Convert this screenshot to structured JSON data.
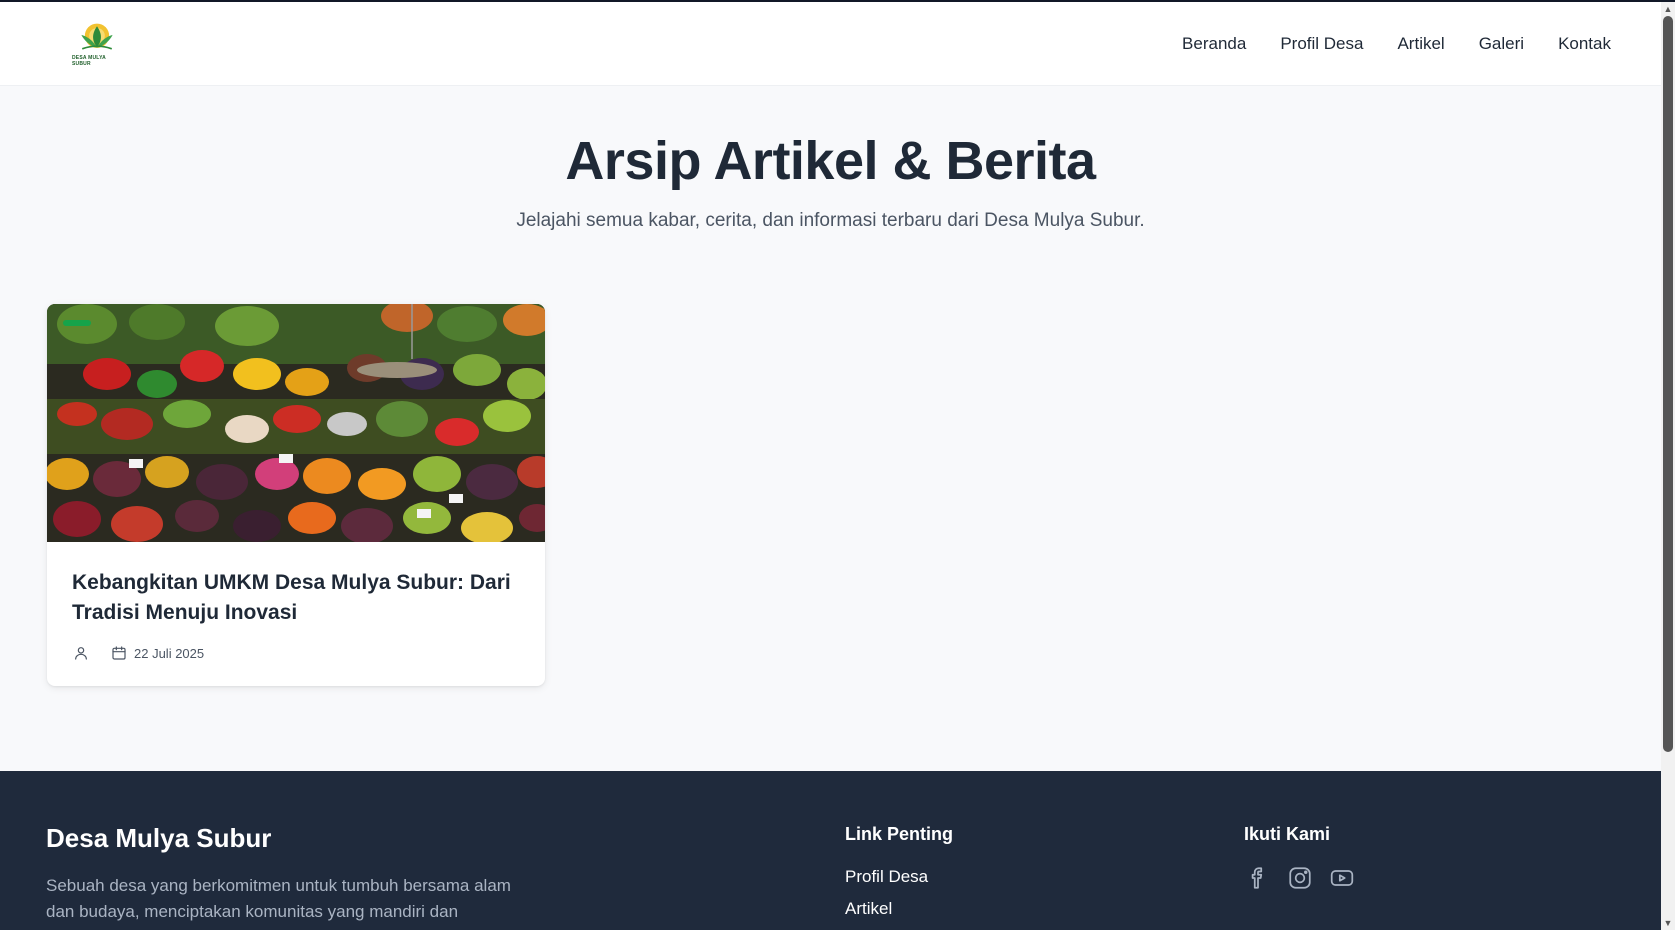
{
  "header": {
    "logo_text": "DESA MULYA SUBUR",
    "nav": [
      "Beranda",
      "Profil Desa",
      "Artikel",
      "Galeri",
      "Kontak"
    ]
  },
  "hero": {
    "title": "Arsip Artikel & Berita",
    "subtitle": "Jelajahi semua kabar, cerita, dan informasi terbaru dari Desa Mulya Subur."
  },
  "articles": [
    {
      "title": "Kebangkitan UMKM Desa Mulya Subur: Dari Tradisi Menuju Inovasi",
      "author": "",
      "date": "22 Juli 2025",
      "image": "vegetable-market-photo"
    }
  ],
  "footer": {
    "brand": "Desa Mulya Subur",
    "description": "Sebuah desa yang berkomitmen untuk tumbuh bersama alam dan budaya, menciptakan komunitas yang mandiri dan",
    "links_title": "Link Penting",
    "links": [
      "Profil Desa",
      "Artikel"
    ],
    "follow_title": "Ikuti Kami",
    "social_icons": [
      "facebook-icon",
      "instagram-icon",
      "youtube-icon"
    ]
  },
  "colors": {
    "footer_bg": "#1f2a3c",
    "page_bg": "#f8f9fb",
    "accent_green": "#16a34a"
  }
}
